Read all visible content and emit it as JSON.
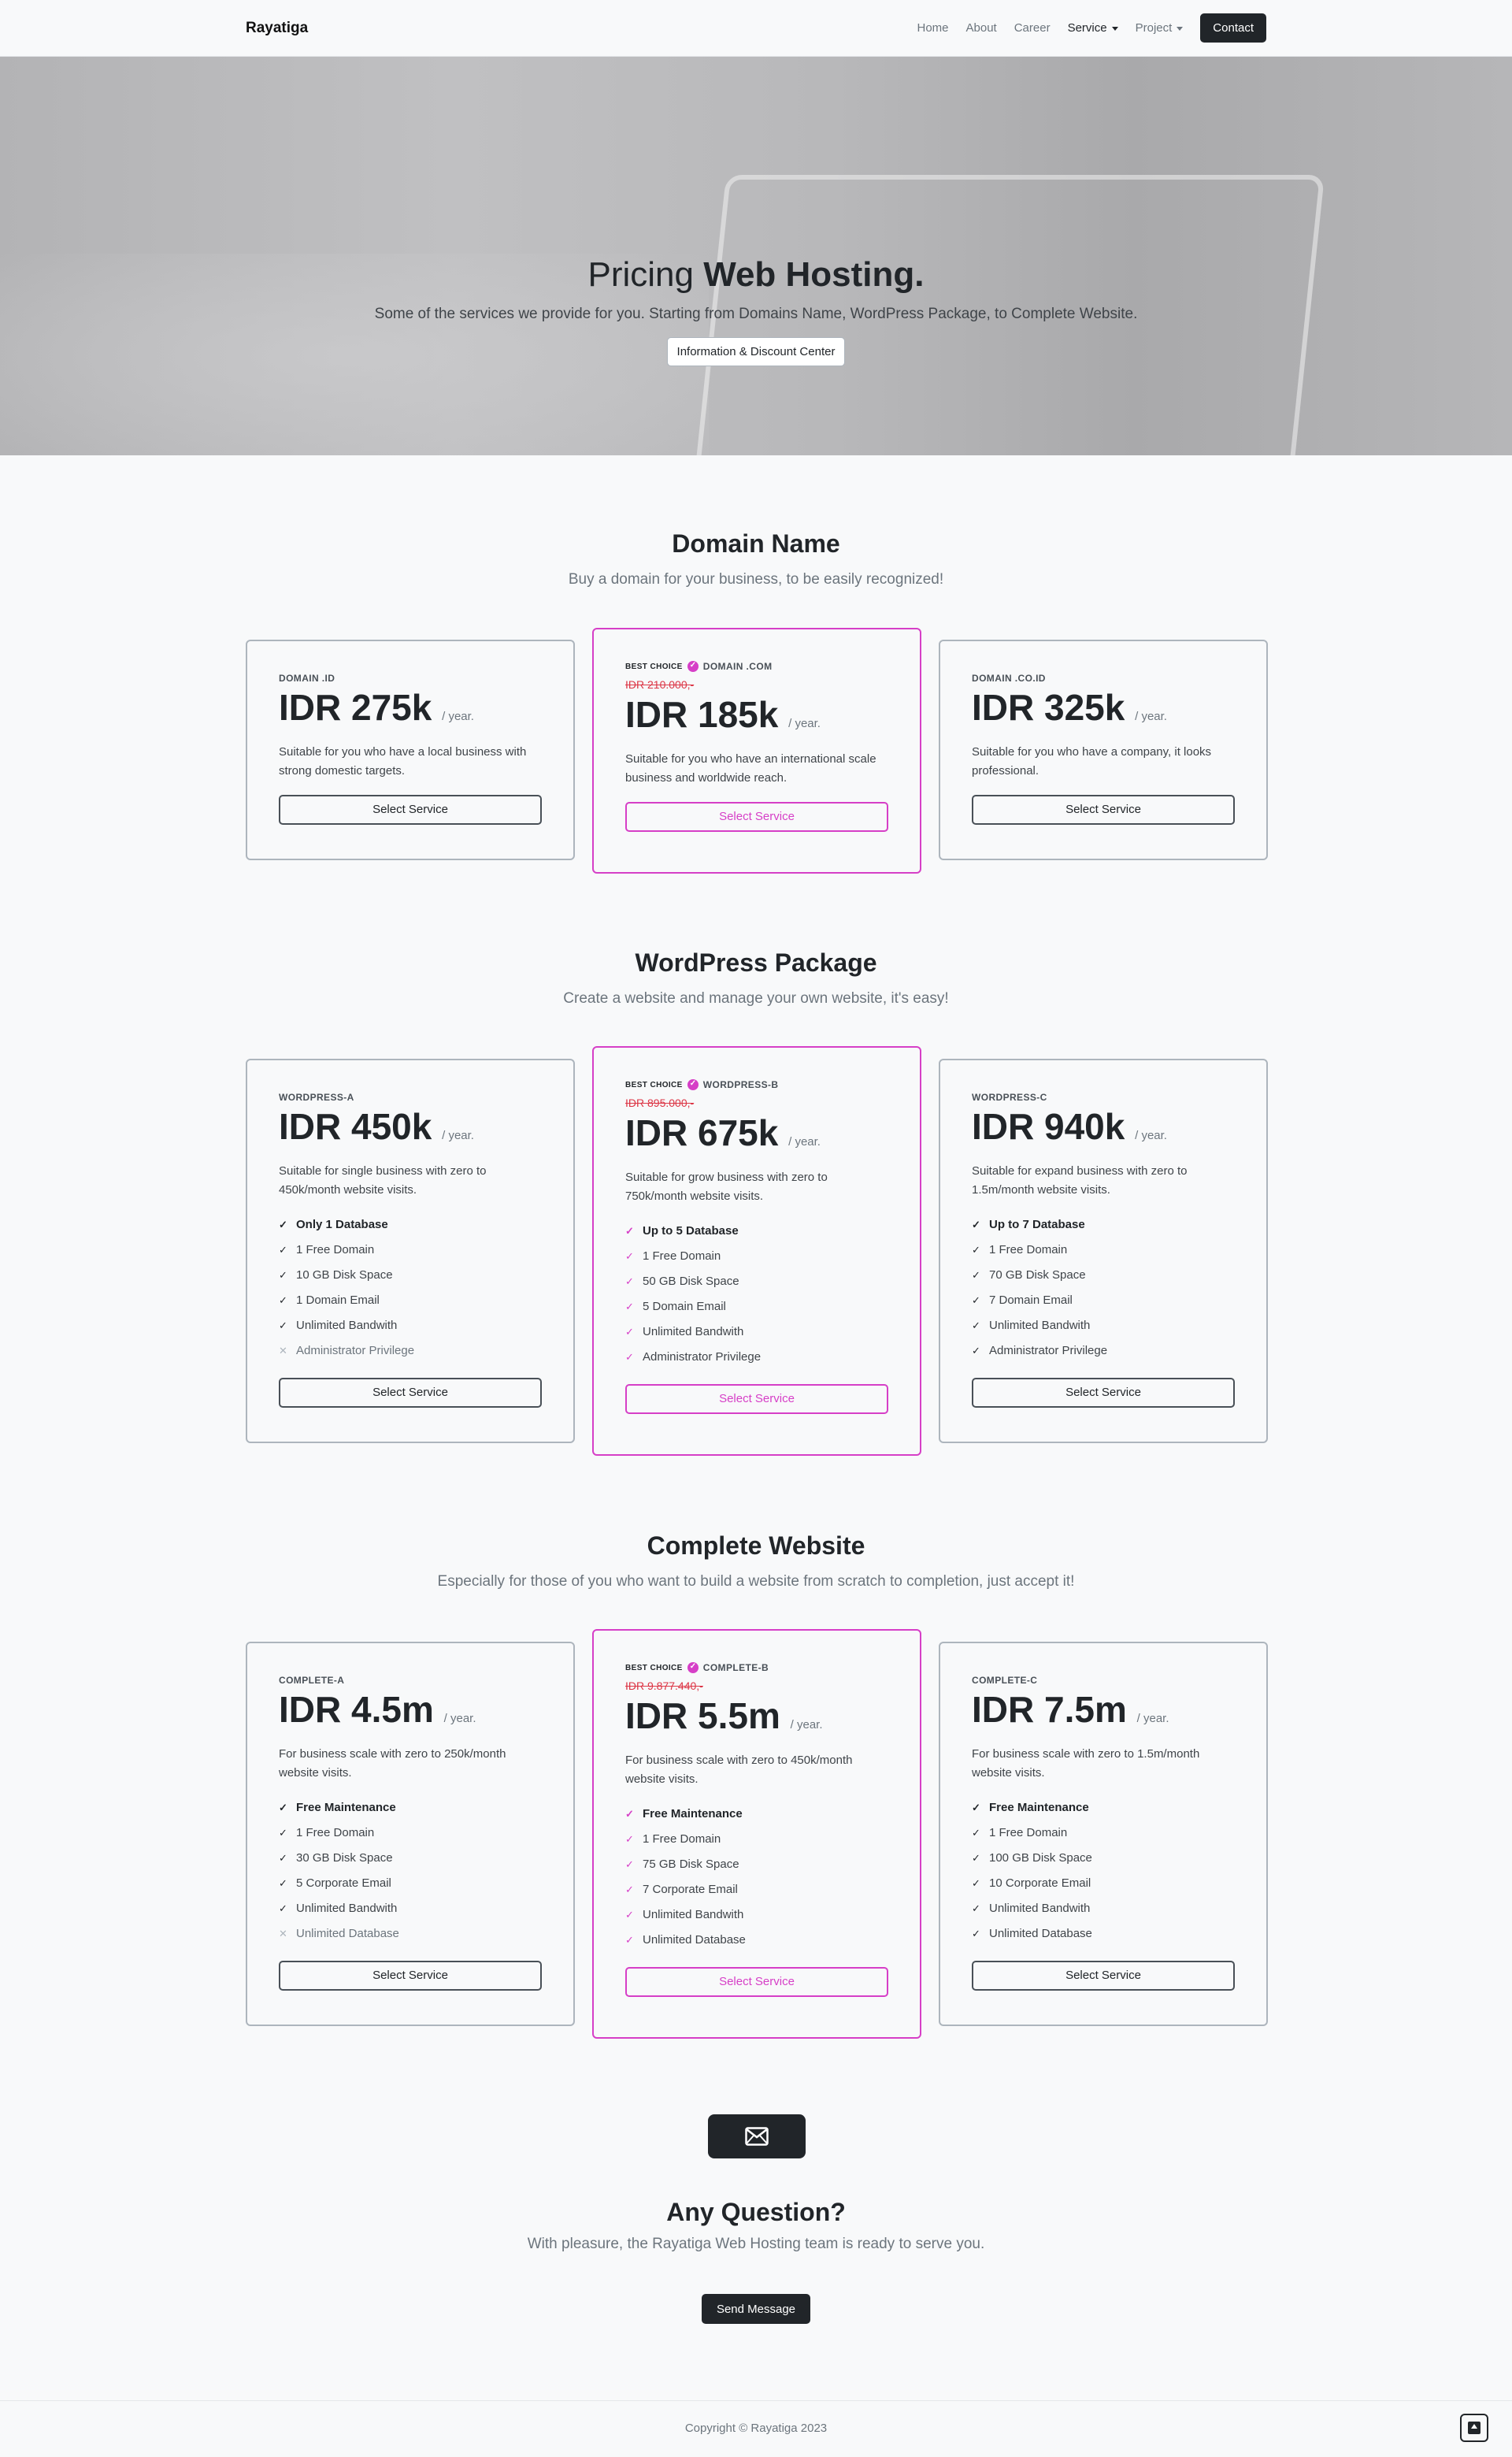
{
  "navbar": {
    "brand": "Rayatiga",
    "links": [
      "Home",
      "About",
      "Career"
    ],
    "service": "Service",
    "project": "Project",
    "contact": "Contact"
  },
  "hero": {
    "title_light": "Pricing",
    "title_bold": "Web Hosting.",
    "subtitle": "Some of the services we provide for you. Starting from Domains Name, WordPress Package, to Complete Website.",
    "button": "Information & Discount Center"
  },
  "best_choice_label": "BEST CHOICE",
  "per_year": "/ year.",
  "select_label": "Select Service",
  "domain": {
    "title": "Domain Name",
    "lead": "Buy a domain for your business, to be easily recognized!",
    "cards": [
      {
        "plan": "DOMAIN .ID",
        "price": "IDR 275k",
        "desc": "Suitable for you who have a local business with strong domestic targets."
      },
      {
        "plan": "DOMAIN .COM",
        "old": "IDR 210.000,-",
        "price": "IDR 185k",
        "desc": "Suitable for you who have an international scale business and worldwide reach."
      },
      {
        "plan": "DOMAIN .CO.ID",
        "price": "IDR 325k",
        "desc": "Suitable for you who have a company, it looks professional."
      }
    ]
  },
  "wordpress": {
    "title": "WordPress Package",
    "lead": "Create a website and manage your own website, it's easy!",
    "cards": [
      {
        "plan": "WORDPRESS-A",
        "price": "IDR 450k",
        "desc": "Suitable for single business with zero to 450k/month website visits.",
        "features": [
          "Only 1 Database",
          "1 Free Domain",
          "10 GB Disk Space",
          "1 Domain Email",
          "Unlimited Bandwith",
          "Administrator Privilege"
        ]
      },
      {
        "plan": "WORDPRESS-B",
        "old": "IDR 895.000,-",
        "price": "IDR 675k",
        "desc": "Suitable for grow business with zero to 750k/month website visits.",
        "features": [
          "Up to 5 Database",
          "1 Free Domain",
          "50 GB Disk Space",
          "5 Domain Email",
          "Unlimited Bandwith",
          "Administrator Privilege"
        ]
      },
      {
        "plan": "WORDPRESS-C",
        "price": "IDR 940k",
        "desc": "Suitable for expand business with zero to 1.5m/month website visits.",
        "features": [
          "Up to 7 Database",
          "1 Free Domain",
          "70 GB Disk Space",
          "7 Domain Email",
          "Unlimited Bandwith",
          "Administrator Privilege"
        ]
      }
    ]
  },
  "complete": {
    "title": "Complete Website",
    "lead": "Especially for those of you who want to build a website from scratch to completion, just accept it!",
    "cards": [
      {
        "plan": "COMPLETE-A",
        "price": "IDR 4.5m",
        "desc": "For business scale with zero to 250k/month website visits.",
        "features": [
          "Free Maintenance",
          "1 Free Domain",
          "30 GB Disk Space",
          "5 Corporate Email",
          "Unlimited Bandwith",
          "Unlimited Database"
        ]
      },
      {
        "plan": "COMPLETE-B",
        "old": "IDR 9.877.440,-",
        "price": "IDR 5.5m",
        "desc": "For business scale with zero to 450k/month website visits.",
        "features": [
          "Free Maintenance",
          "1 Free Domain",
          "75 GB Disk Space",
          "7 Corporate Email",
          "Unlimited Bandwith",
          "Unlimited Database"
        ]
      },
      {
        "plan": "COMPLETE-C",
        "price": "IDR 7.5m",
        "desc": "For business scale with zero to 1.5m/month website visits.",
        "features": [
          "Free Maintenance",
          "1 Free Domain",
          "100 GB Disk Space",
          "10 Corporate Email",
          "Unlimited Bandwith",
          "Unlimited Database"
        ]
      }
    ]
  },
  "question": {
    "title": "Any Question?",
    "subtitle": "With pleasure, the Rayatiga Web Hosting team is ready to serve you.",
    "button": "Send Message"
  },
  "footer": {
    "copyright": "Copyright © Rayatiga 2023"
  },
  "icons": {
    "mail": "envelope-icon",
    "to_top": "arrow-up-square-icon",
    "check": "check-icon",
    "cross": "x-icon"
  },
  "colors": {
    "accent": "#d63fc7",
    "dark": "#212529",
    "strike": "#dc3545"
  }
}
